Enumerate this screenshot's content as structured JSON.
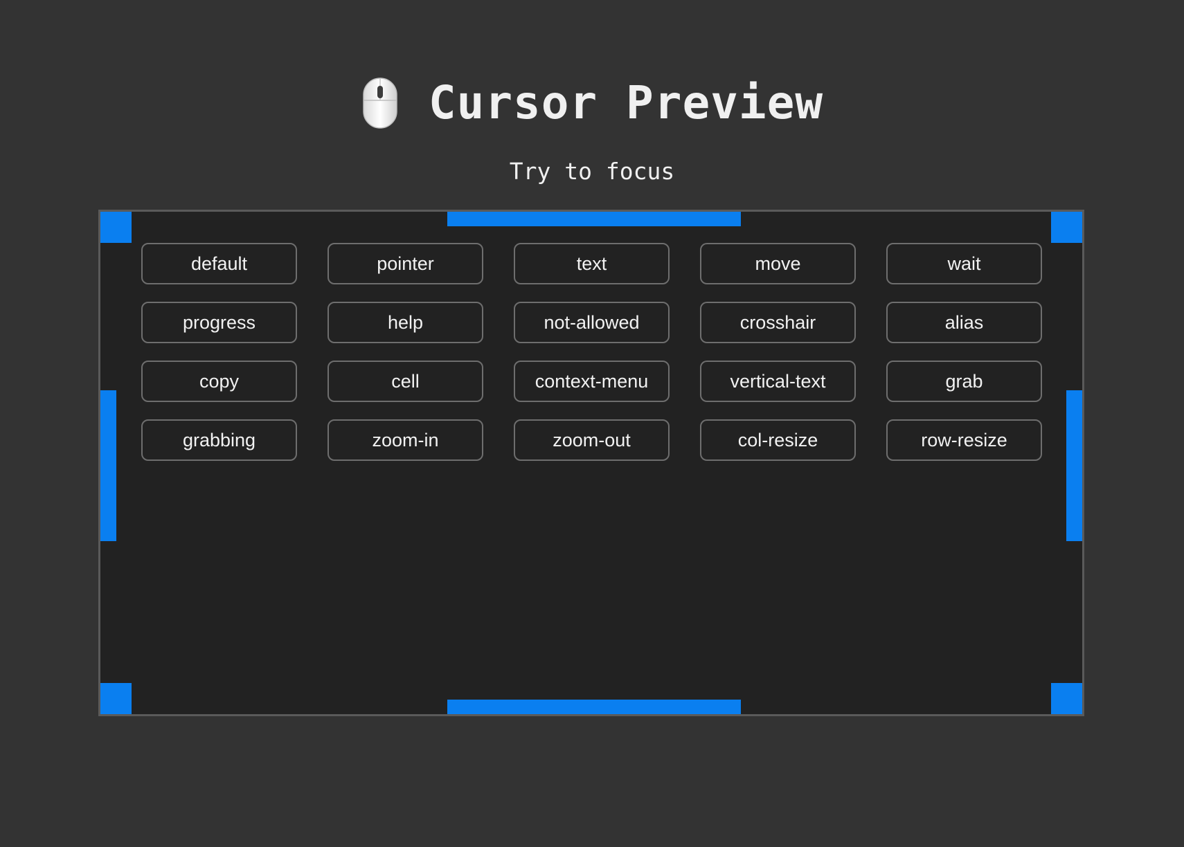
{
  "header": {
    "title": "Cursor Preview",
    "icon": "mouse-icon",
    "subtitle": "Try to focus"
  },
  "colors": {
    "background": "#333333",
    "panel": "#222222",
    "accent": "#0a7ff0",
    "border": "#5a5a5a",
    "text": "#f0f0f0"
  },
  "cursors": [
    "default",
    "pointer",
    "text",
    "move",
    "wait",
    "progress",
    "help",
    "not-allowed",
    "crosshair",
    "alias",
    "copy",
    "cell",
    "context-menu",
    "vertical-text",
    "grab",
    "grabbing",
    "zoom-in",
    "zoom-out",
    "col-resize",
    "row-resize"
  ]
}
